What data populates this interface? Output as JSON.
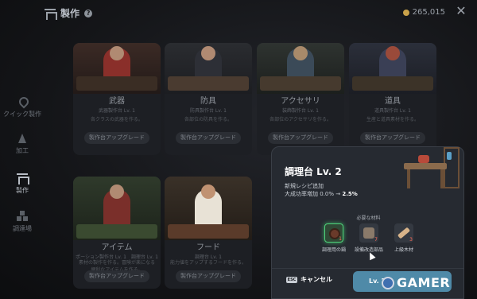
{
  "header": {
    "title": "製作",
    "help": "?",
    "currency": "265,015",
    "close": "✕"
  },
  "sidebar": {
    "items": [
      {
        "label": "クイック製作",
        "icon": "quick-craft-icon",
        "active": false
      },
      {
        "label": "加工",
        "icon": "processing-icon",
        "active": false
      },
      {
        "label": "製作",
        "icon": "craft-icon",
        "active": true
      },
      {
        "label": "調達場",
        "icon": "gathering-icon",
        "active": false
      }
    ]
  },
  "cards": [
    {
      "name": "武器",
      "level": "武器製作台 Lv. 1",
      "desc": "各クラスの武器を作る。",
      "button": "製作台アップグレード"
    },
    {
      "name": "防具",
      "level": "防具製作台 Lv. 1",
      "desc": "各部位の防具を作る。",
      "button": "製作台アップグレード"
    },
    {
      "name": "アクセサリ",
      "level": "装飾製作台 Lv. 1",
      "desc": "各部位のアクセサリを作る。",
      "button": "製作台アップグレード"
    },
    {
      "name": "道具",
      "level": "道具製作台 Lv. 1",
      "desc": "生産と道具素材を作る。",
      "button": "製作台アップグレード"
    },
    {
      "name": "アイテム",
      "level": "ポーション製作台 Lv. 1　調理台 Lv. 1",
      "desc": "素材の製作を作る。冒険が楽になる便利なアイテムを作る。",
      "button": "製作台アップグレード"
    },
    {
      "name": "フード",
      "level": "調理台 Lv. 1",
      "desc": "能力値をアップするフードを作る。",
      "button": "製作台アップグレード"
    }
  ],
  "dialog": {
    "title": "調理台 Lv. 2",
    "line1": "新規レシピ追加",
    "line2_prefix": "大成功率増加 ",
    "line2_from": "0.0%",
    "line2_arrow": " → ",
    "line2_to": "2.5%",
    "materials_header": "必要な材料",
    "materials": [
      {
        "label": "調理用の鍋",
        "count": "1",
        "icon": "cooking-pot-icon",
        "selected": true
      },
      {
        "label": "設備改造部品",
        "count": "7",
        "icon": "repair-parts-icon",
        "selected": false
      },
      {
        "label": "上級木材",
        "count": "3",
        "icon": "lumber-icon",
        "selected": false
      }
    ],
    "esc_key": "ESC",
    "cancel": "キャンセル",
    "confirm": "Lv. 2"
  },
  "watermark": {
    "text": "GAMER"
  },
  "colors": {
    "accent": "#4f8aa8",
    "selected": "#4fd27a",
    "coin": "#c9a24a",
    "warning": "#ff6b5a"
  }
}
